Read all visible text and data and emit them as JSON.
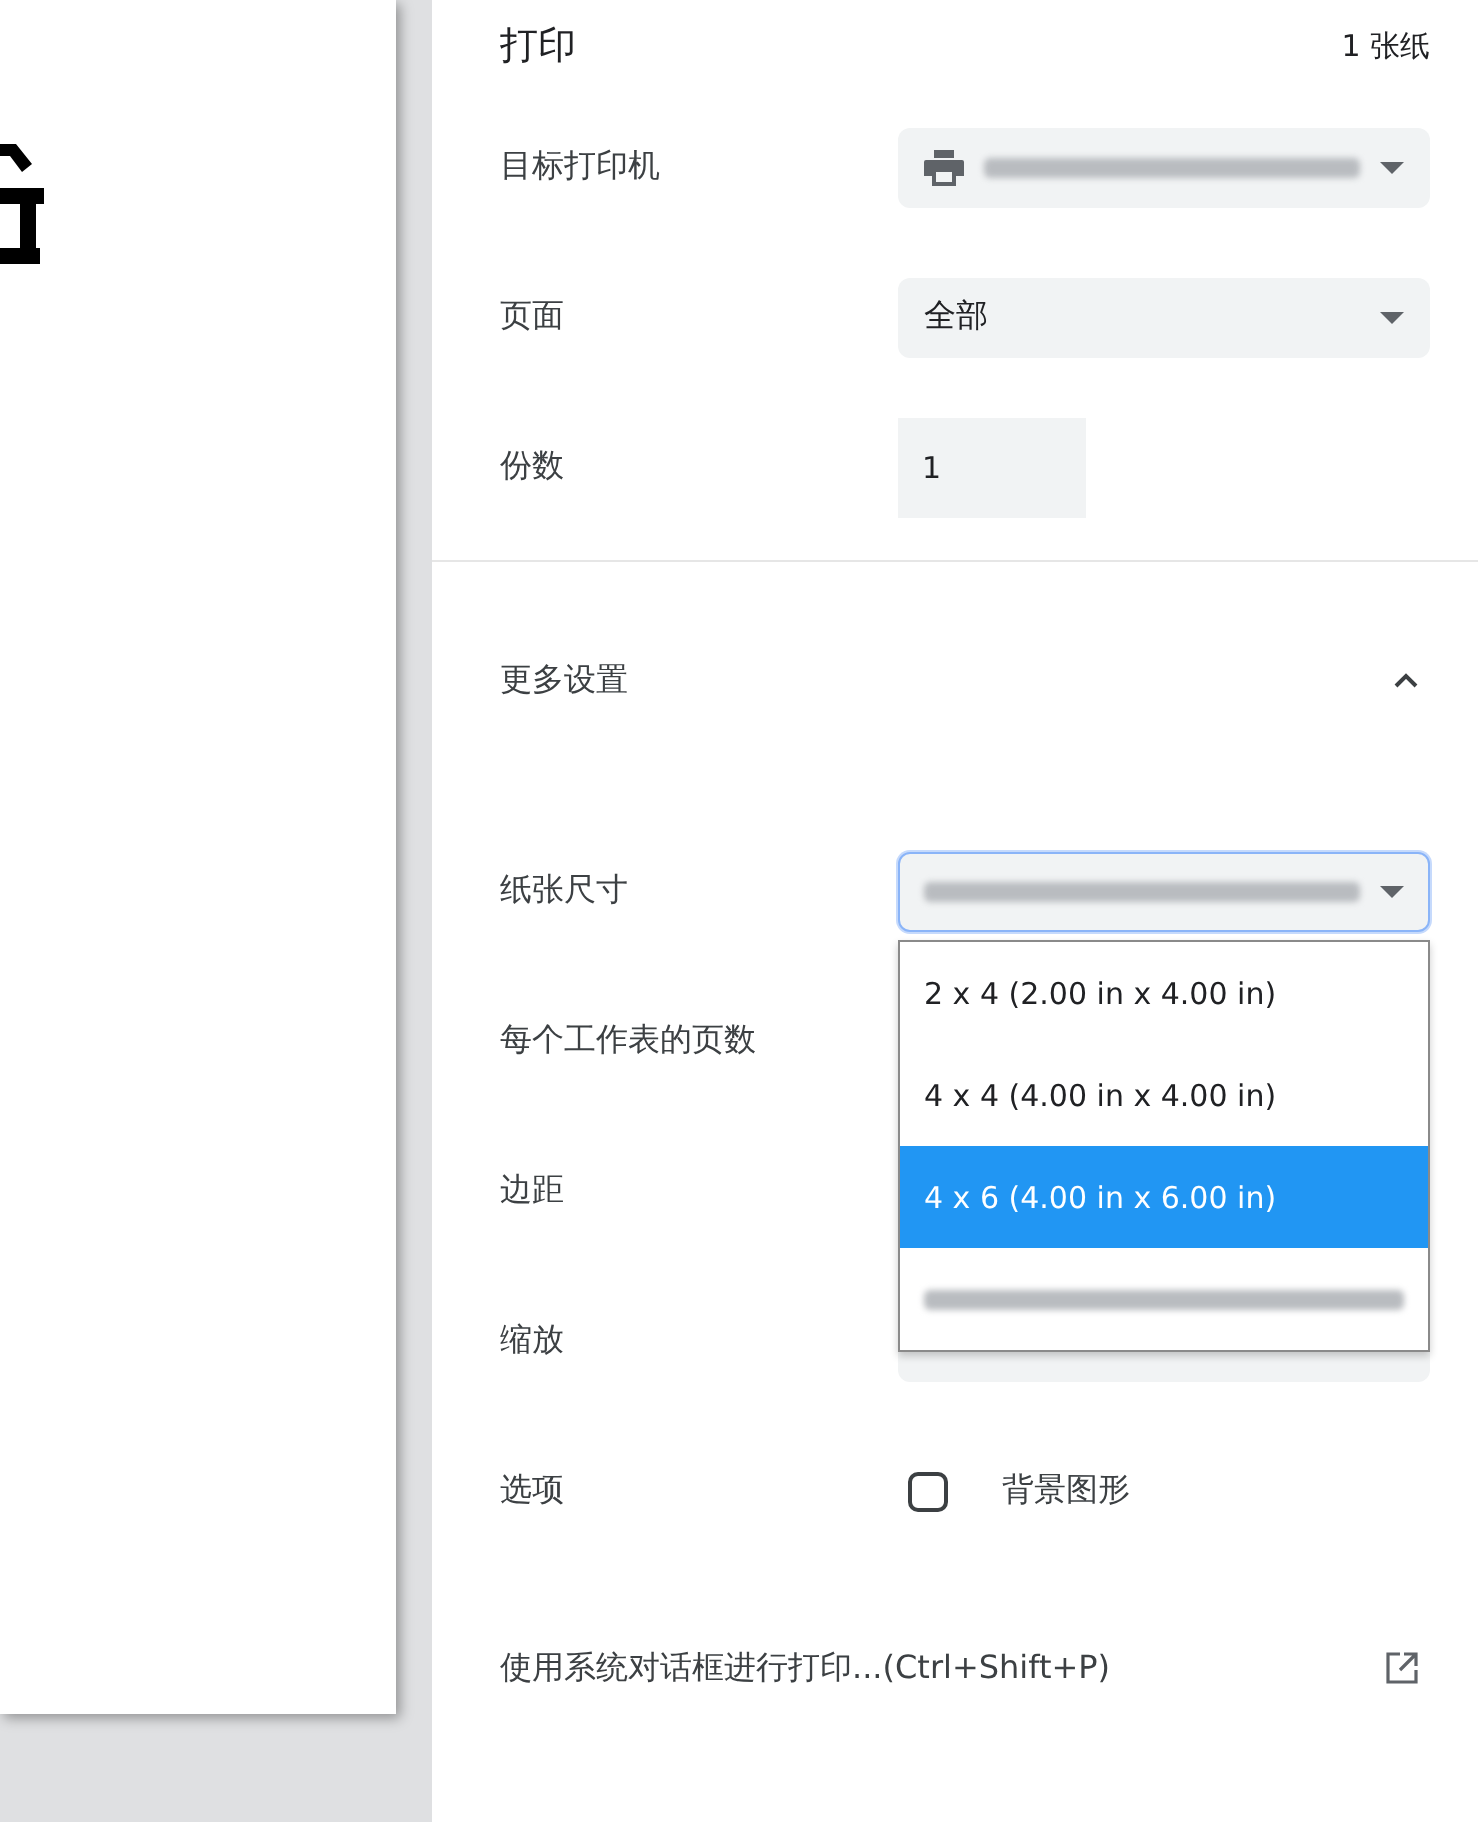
{
  "header": {
    "title": "打印",
    "sheets": "1 张纸"
  },
  "basic": [
    {
      "kind": "printer",
      "label": "目标打印机",
      "redacted": true
    },
    {
      "kind": "select",
      "label": "页面",
      "value": "全部"
    },
    {
      "kind": "number",
      "label": "份数",
      "value": "1"
    }
  ],
  "more": {
    "label": "更多设置",
    "expanded": true
  },
  "advanced": [
    {
      "kind": "select",
      "label": "纸张尺寸",
      "redacted": true,
      "focused": true
    },
    {
      "kind": "covered",
      "label": "每个工作表的页数"
    },
    {
      "kind": "covered",
      "label": "边距"
    },
    {
      "kind": "covered_select",
      "label": "缩放"
    },
    {
      "kind": "checkbox",
      "label": "选项",
      "text": "背景图形",
      "checked": false
    }
  ],
  "paper_menu": [
    {
      "label": "2 x 4 (2.00 in x 4.00 in)",
      "selected": false
    },
    {
      "label": "4 x 4 (4.00 in x 4.00 in)",
      "selected": false
    },
    {
      "label": "4 x 6 (4.00 in x 6.00 in)",
      "selected": true
    },
    {
      "redacted": true,
      "selected": false
    }
  ],
  "system_dialog": "使用系统对话框进行打印...(Ctrl+Shift+P)"
}
